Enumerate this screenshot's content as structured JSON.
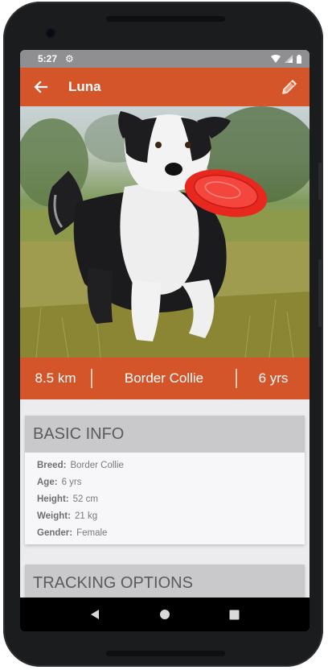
{
  "status": {
    "time": "5:27"
  },
  "header": {
    "title": "Luna",
    "back_icon": "arrow-left-icon",
    "edit_icon": "pencil-icon"
  },
  "summary": {
    "distance": "8.5 km",
    "breed": "Border Collie",
    "age": "6 yrs"
  },
  "basic_info": {
    "title": "BASIC INFO",
    "rows": [
      {
        "label": "Breed:",
        "value": "Border Collie"
      },
      {
        "label": "Age:",
        "value": "6 yrs"
      },
      {
        "label": "Height:",
        "value": "52 cm"
      },
      {
        "label": "Weight:",
        "value": "21 kg"
      },
      {
        "label": "Gender:",
        "value": "Female"
      }
    ]
  },
  "tracking": {
    "title": "TRACKING OPTIONS"
  },
  "colors": {
    "accent": "#d5552b",
    "header_card": "#c9c9cc"
  }
}
